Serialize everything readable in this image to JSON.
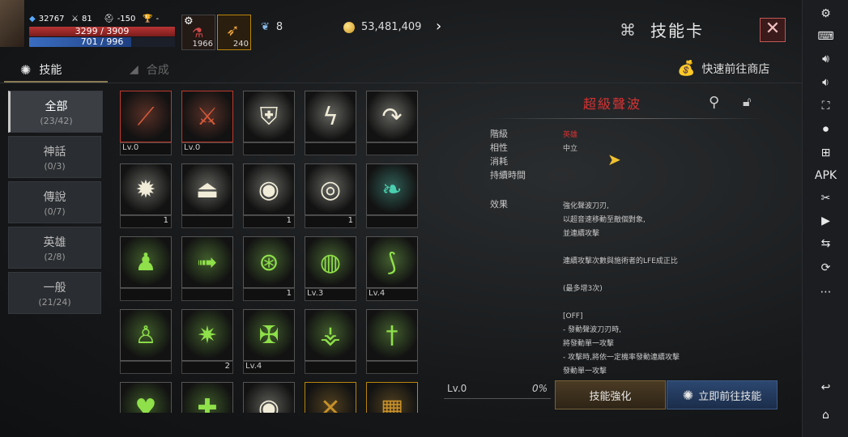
{
  "hud": {
    "power": "32767",
    "attack": "81",
    "defense": "-150",
    "trophy": "-",
    "hp": "3299 / 3909",
    "mp": "701 / 996",
    "slot1_count": "1966",
    "slot2_count": "240",
    "wings": "8",
    "gold": "53,481,409"
  },
  "header": {
    "title": "技能卡",
    "close": "✕"
  },
  "tabs": [
    {
      "label": "技能"
    },
    {
      "label": "合成"
    }
  ],
  "shop_link": "快速前往商店",
  "categories": [
    {
      "label": "全部",
      "count": "(23/42)"
    },
    {
      "label": "神話",
      "count": "(0/3)"
    },
    {
      "label": "傳說",
      "count": "(0/7)"
    },
    {
      "label": "英雄",
      "count": "(2/8)"
    },
    {
      "label": "一般",
      "count": "(21/24)"
    }
  ],
  "grid": [
    {
      "lv": "Lv.0",
      "n": "",
      "border": "red",
      "icon": "slash-red"
    },
    {
      "lv": "Lv.0",
      "n": "",
      "border": "red",
      "icon": "sword-red"
    },
    {
      "lv": "",
      "n": "",
      "border": "",
      "icon": "shield-white"
    },
    {
      "lv": "",
      "n": "",
      "border": "",
      "icon": "lightning-white"
    },
    {
      "lv": "",
      "n": "",
      "border": "",
      "icon": "arrow-white"
    },
    {
      "lv": "",
      "n": "1",
      "border": "",
      "icon": "burst-white"
    },
    {
      "lv": "",
      "n": "",
      "border": "",
      "icon": "anvil-white"
    },
    {
      "lv": "",
      "n": "1",
      "border": "",
      "icon": "eye-white"
    },
    {
      "lv": "",
      "n": "1",
      "border": "",
      "icon": "ring-white"
    },
    {
      "lv": "",
      "n": "",
      "border": "",
      "icon": "leaf-teal"
    },
    {
      "lv": "",
      "n": "",
      "border": "",
      "icon": "aura-green"
    },
    {
      "lv": "",
      "n": "",
      "border": "",
      "icon": "dash-green"
    },
    {
      "lv": "",
      "n": "1",
      "border": "",
      "icon": "circle-green"
    },
    {
      "lv": "Lv.3",
      "n": "",
      "border": "",
      "icon": "swirl-green"
    },
    {
      "lv": "Lv.4",
      "n": "",
      "border": "",
      "icon": "blade-green"
    },
    {
      "lv": "",
      "n": "",
      "border": "",
      "icon": "body-green"
    },
    {
      "lv": "",
      "n": "2",
      "border": "",
      "icon": "spike-green"
    },
    {
      "lv": "Lv.4",
      "n": "",
      "border": "",
      "icon": "crest-green"
    },
    {
      "lv": "",
      "n": "",
      "border": "",
      "icon": "claw-green"
    },
    {
      "lv": "",
      "n": "",
      "border": "",
      "icon": "sword-green"
    },
    {
      "lv": "",
      "n": "",
      "border": "",
      "icon": "heart-green"
    },
    {
      "lv": "",
      "n": "",
      "border": "",
      "icon": "cross-green"
    },
    {
      "lv": "",
      "n": "",
      "border": "",
      "icon": "eye-white"
    },
    {
      "lv": "",
      "n": "",
      "border": "gold",
      "icon": "flash-gold"
    },
    {
      "lv": "",
      "n": "",
      "border": "gold",
      "icon": "dark-gold"
    }
  ],
  "detail": {
    "name": "超級聲波",
    "labels": {
      "grade": "階級",
      "affinity": "相性",
      "cost": "消耗",
      "duration": "持續時間",
      "effect": "效果"
    },
    "grade": "英雄",
    "affinity": "中立",
    "effect_text": "強化聲波刀刃,\n以超音速移動至敵個對象,\n並連續攻擊\n\n連續攻擊次數與施術者的LFE成正比\n\n(最多增3次)\n\n[OFF]\n- 發動聲波刀刃時,\n將發動單一攻擊\n- 攻擊時,將依一定機率發動連續攻擊\n發動單一攻擊",
    "level": "Lv.0",
    "progress": "0%"
  },
  "buttons": {
    "enhance": "技能強化",
    "goto": "立即前往技能"
  },
  "colors": {
    "accent_red": "#d83232",
    "gold": "#c9961e",
    "panel": "#2a2d31"
  }
}
